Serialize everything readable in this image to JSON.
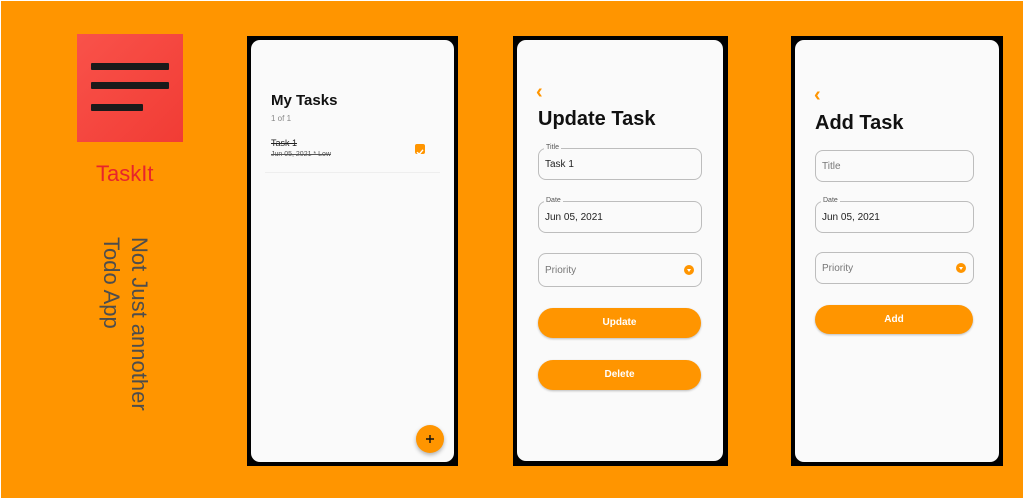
{
  "promo": {
    "logo_icon": "menu-lines-icon",
    "brand": "TaskIt",
    "tagline_line1": "Not Just annother",
    "tagline_line2": "Todo App",
    "colors": {
      "background": "#ff9500",
      "accent": "#ff9500",
      "brand_red": "#e8242b"
    }
  },
  "tasks_screen": {
    "title": "My Tasks",
    "count": "1 of 1",
    "tasks": [
      {
        "title": "Task 1",
        "meta": "Jun 05, 2021 * Low",
        "checked": true
      }
    ],
    "fab_icon": "plus-icon",
    "fab_label": "+"
  },
  "update_screen": {
    "back_icon": "chevron-left-icon",
    "back_glyph": "‹",
    "title": "Update Task",
    "title_field": {
      "label": "Title",
      "value": "Task 1"
    },
    "date_field": {
      "label": "Date",
      "value": "Jun 05, 2021"
    },
    "priority_field": {
      "placeholder": "Priority"
    },
    "update_button": "Update",
    "delete_button": "Delete"
  },
  "add_screen": {
    "back_icon": "chevron-left-icon",
    "back_glyph": "‹",
    "title": "Add Task",
    "title_field": {
      "placeholder": "Title"
    },
    "date_field": {
      "label": "Date",
      "value": "Jun 05, 2021"
    },
    "priority_field": {
      "placeholder": "Priority"
    },
    "add_button": "Add"
  }
}
